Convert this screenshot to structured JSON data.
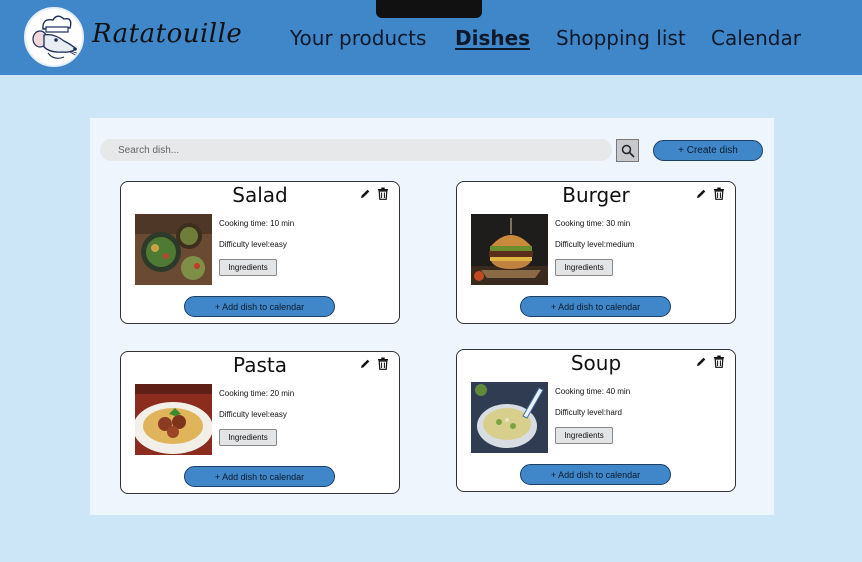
{
  "header": {
    "brand": "Ratatouille",
    "nav": [
      "Your products",
      "Dishes",
      "Shopping list",
      "Calendar"
    ],
    "active": "Dishes"
  },
  "search": {
    "placeholder": "Search dish..."
  },
  "create_label": "+ Create dish",
  "dishes": [
    {
      "name": "Salad",
      "cooking": "Cooking time: 10 min",
      "difficulty": "Difficulty level:easy",
      "ingredients": "Ingredients",
      "add": "+ Add dish to calendar"
    },
    {
      "name": "Burger",
      "cooking": "Cooking time: 30 min",
      "difficulty": "Difficulty level:medium",
      "ingredients": "Ingredients",
      "add": "+ Add dish to calendar"
    },
    {
      "name": "Pasta",
      "cooking": "Cooking time: 20 min",
      "difficulty": "Difficulty level:easy",
      "ingredients": "Ingredients",
      "add": "+ Add dish to calendar"
    },
    {
      "name": "Soup",
      "cooking": "Cooking time: 40 min",
      "difficulty": "Difficulty level:hard",
      "ingredients": "Ingredients",
      "add": "+ Add dish to calendar"
    }
  ],
  "colors": {
    "header": "#3f87c9",
    "background": "#cde6f7",
    "panel": "#eef5fc",
    "button": "#3f87c9"
  },
  "icons": [
    "chef-mouse-logo",
    "search-icon",
    "pencil-icon",
    "trash-icon"
  ]
}
